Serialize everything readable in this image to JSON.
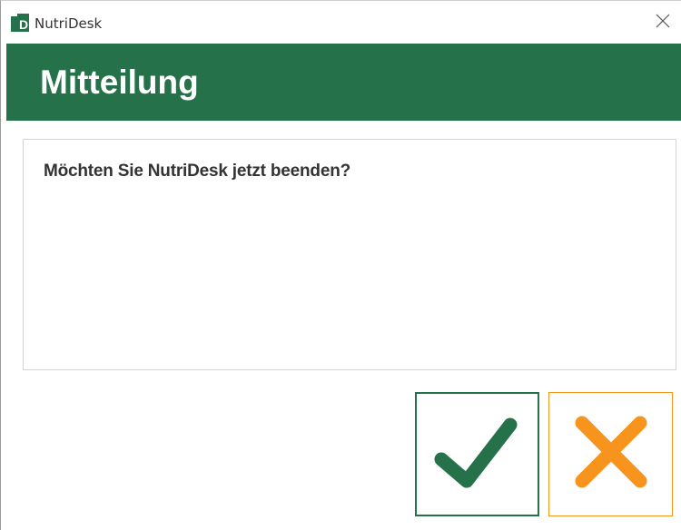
{
  "window": {
    "title": "NutriDesk",
    "app_icon": "nutridesk-logo-icon",
    "close_icon": "close-icon"
  },
  "header": {
    "title": "Mitteilung",
    "color": "#24714a"
  },
  "message": {
    "text": "Möchten Sie NutriDesk jetzt beenden?"
  },
  "buttons": {
    "confirm": {
      "icon": "checkmark-icon",
      "color": "#24714a"
    },
    "cancel": {
      "icon": "cross-icon",
      "color": "#f7941d"
    }
  }
}
